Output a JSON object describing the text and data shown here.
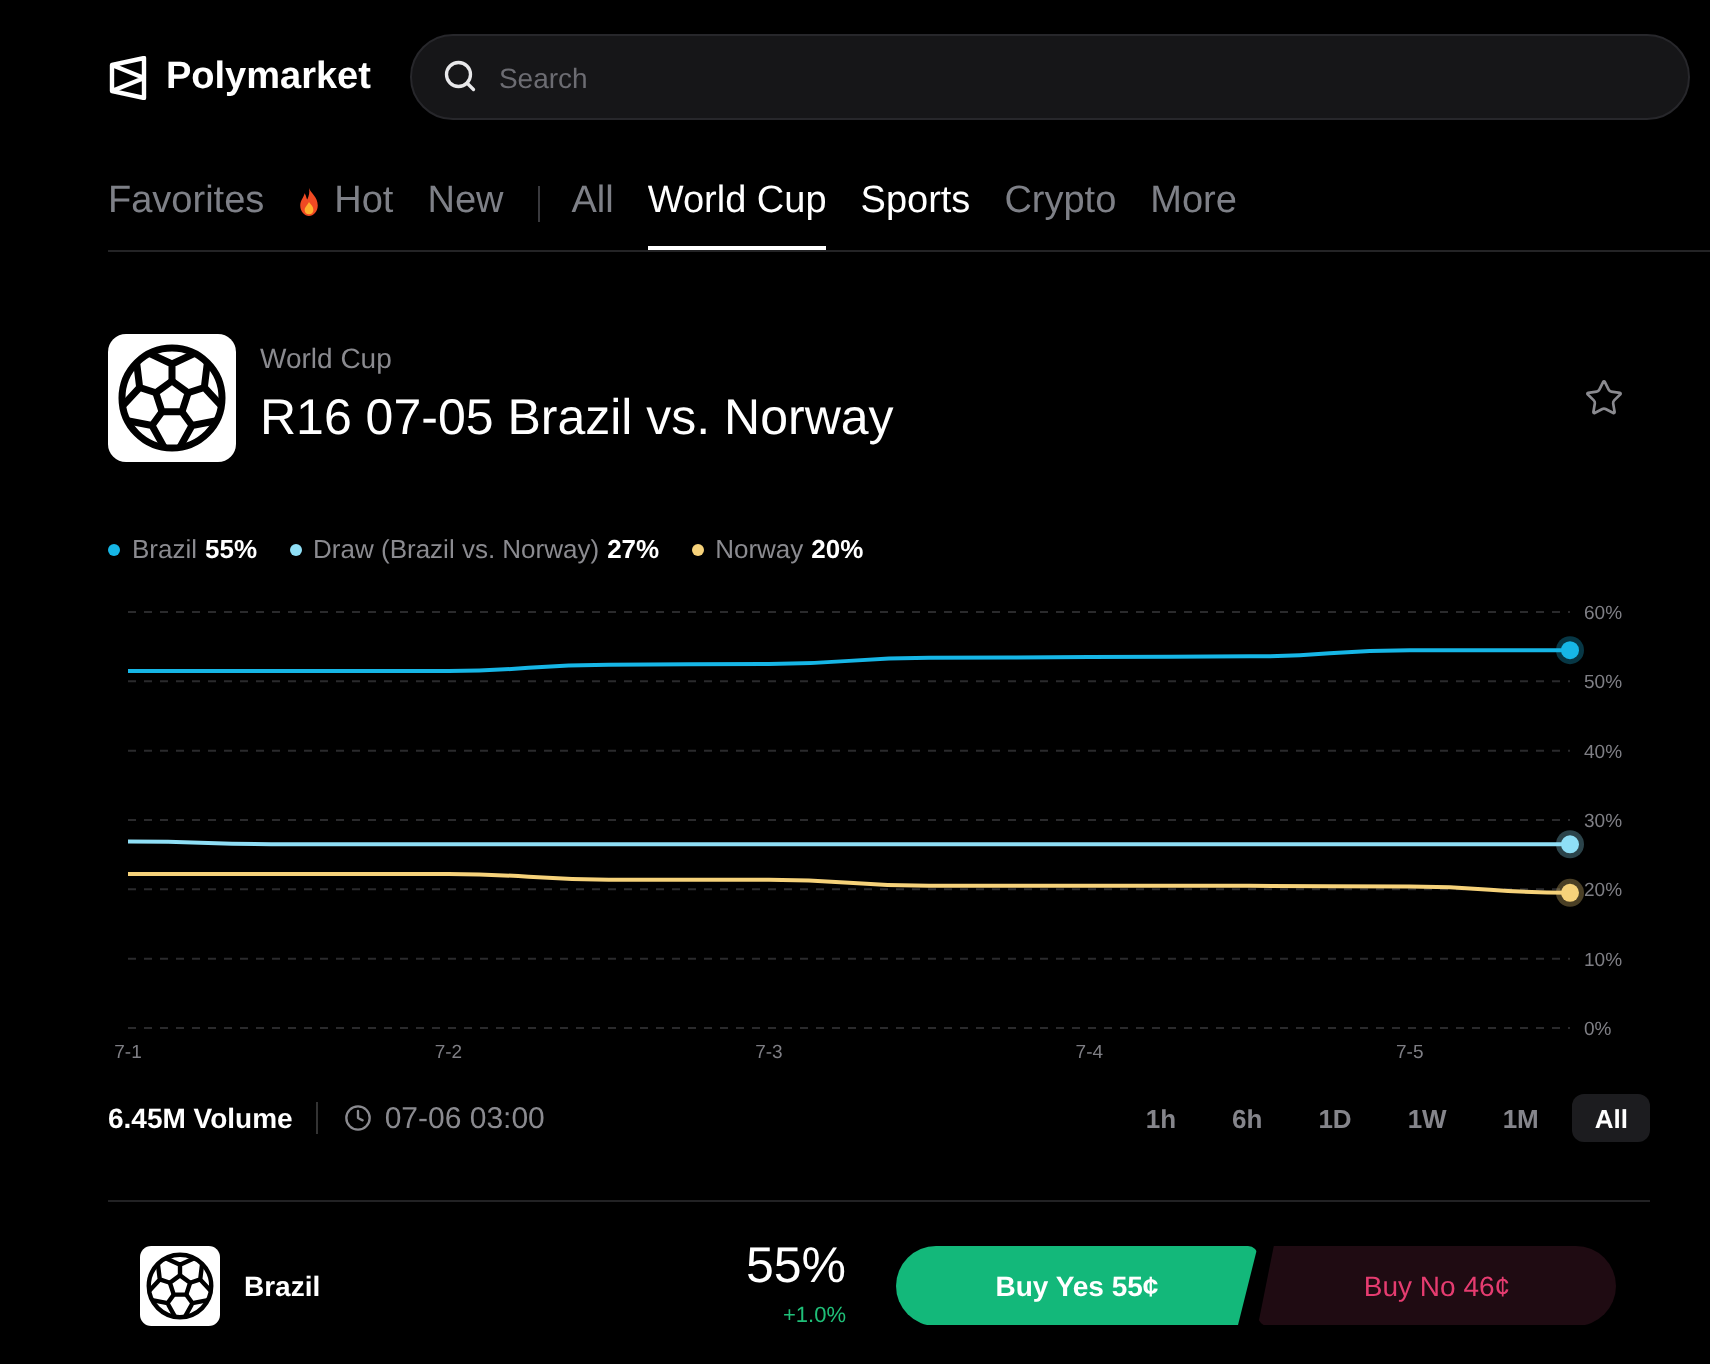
{
  "header": {
    "logo": "Polymarket",
    "search": {
      "placeholder": "Search"
    }
  },
  "nav": {
    "feeds": [
      {
        "label": "Favorites",
        "kind": "plain",
        "selected": false,
        "highlighted": false
      },
      {
        "label": "Hot",
        "kind": "trending",
        "selected": false,
        "highlighted": false
      },
      {
        "label": "New",
        "kind": "plain",
        "selected": false,
        "highlighted": false
      }
    ],
    "categories": [
      {
        "label": "All",
        "selected": false,
        "highlighted": false
      },
      {
        "label": "World Cup",
        "selected": true,
        "highlighted": true
      },
      {
        "label": "Sports",
        "selected": false,
        "highlighted": true
      },
      {
        "label": "Crypto",
        "selected": false,
        "highlighted": false
      },
      {
        "label": "More",
        "selected": false,
        "highlighted": false
      }
    ]
  },
  "event": {
    "category": "World Cup",
    "title": "R16 07-05 Brazil vs. Norway",
    "favorite": false
  },
  "chart": {
    "legend": [
      {
        "value": "55%"
      },
      {
        "value": "27%"
      },
      {
        "value": "20%"
      }
    ],
    "chart_data": {
      "type": "line",
      "grid": true,
      "categories": [
        "7-1",
        null,
        "7-2",
        null,
        "7-3",
        null,
        "7-4",
        null,
        "7-5",
        null
      ],
      "ylim": [
        0,
        60
      ],
      "yticks": [
        {
          "value": 0,
          "label": "0%"
        },
        {
          "value": 10,
          "label": "10%"
        },
        {
          "value": 20,
          "label": "20%"
        },
        {
          "value": 30,
          "label": "30%"
        },
        {
          "value": 40,
          "label": "40%"
        },
        {
          "value": 50,
          "label": "50%"
        },
        {
          "value": 60,
          "label": "60%"
        }
      ],
      "series": [
        {
          "name": "Brazil",
          "color": "#16b6e6",
          "values": [
            51.5,
            51.5,
            51.5,
            52.4,
            52.5,
            53.4,
            53.5,
            53.6,
            54.5,
            54.5
          ]
        },
        {
          "name": "Draw (Brazil vs. Norway)",
          "color": "#8fdff6",
          "values": [
            26.9,
            26.5,
            26.5,
            26.5,
            26.5,
            26.5,
            26.5,
            26.5,
            26.5,
            26.5
          ]
        },
        {
          "name": "Norway",
          "color": "#f6d27a",
          "values": [
            22.2,
            22.2,
            22.2,
            21.4,
            21.4,
            20.5,
            20.5,
            20.5,
            20.4,
            19.5
          ]
        }
      ]
    },
    "volume": "6.45M Volume",
    "end_date": "07-06 03:00",
    "ranges": [
      {
        "label": "1h",
        "selected": false
      },
      {
        "label": "6h",
        "selected": false
      },
      {
        "label": "1D",
        "selected": false
      },
      {
        "label": "1W",
        "selected": false
      },
      {
        "label": "1M",
        "selected": false
      },
      {
        "label": "All",
        "selected": true
      }
    ]
  },
  "outcomes": [
    {
      "name": "Brazil",
      "chance": "55%",
      "change": "+1.0%",
      "rising": true,
      "buy_yes": "Buy Yes 55¢",
      "buy_no": "Buy No 46¢"
    }
  ]
}
